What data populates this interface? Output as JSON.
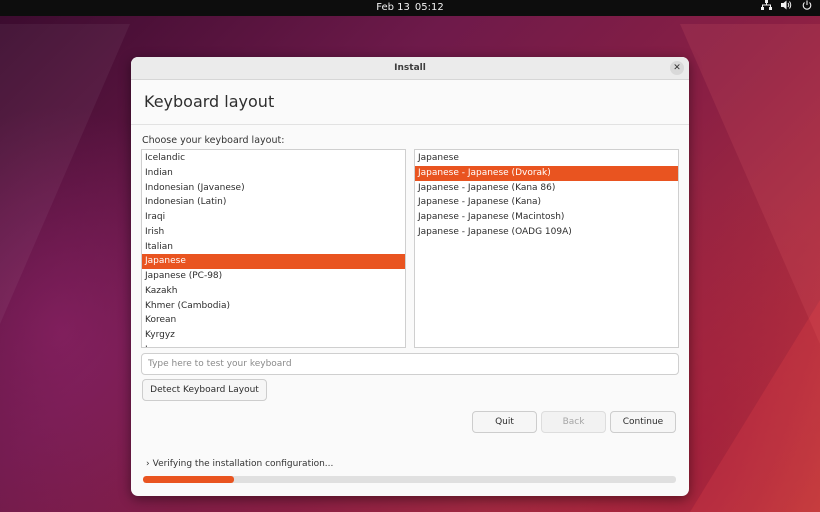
{
  "topbar": {
    "date": "Feb 13",
    "time": "05:12",
    "icons": [
      "network-icon",
      "volume-icon",
      "power-icon"
    ]
  },
  "window": {
    "title": "Install",
    "heading": "Keyboard layout",
    "prompt": "Choose your keyboard layout:"
  },
  "layouts": {
    "items": [
      "Icelandic",
      "Indian",
      "Indonesian (Javanese)",
      "Indonesian (Latin)",
      "Iraqi",
      "Irish",
      "Italian",
      "Japanese",
      "Japanese (PC-98)",
      "Kazakh",
      "Khmer (Cambodia)",
      "Korean",
      "Kyrgyz",
      "Lao"
    ],
    "selected_index": 7
  },
  "variants": {
    "items": [
      "Japanese",
      "Japanese - Japanese (Dvorak)",
      "Japanese - Japanese (Kana 86)",
      "Japanese - Japanese (Kana)",
      "Japanese - Japanese (Macintosh)",
      "Japanese - Japanese (OADG 109A)"
    ],
    "selected_index": 1
  },
  "test_input": {
    "placeholder": "Type here to test your keyboard",
    "value": ""
  },
  "buttons": {
    "detect": "Detect Keyboard Layout",
    "quit": "Quit",
    "back": "Back",
    "continue": "Continue"
  },
  "status": {
    "text": "Verifying the installation configuration...",
    "progress_fraction": 0.17
  },
  "colors": {
    "accent": "#e95420"
  }
}
